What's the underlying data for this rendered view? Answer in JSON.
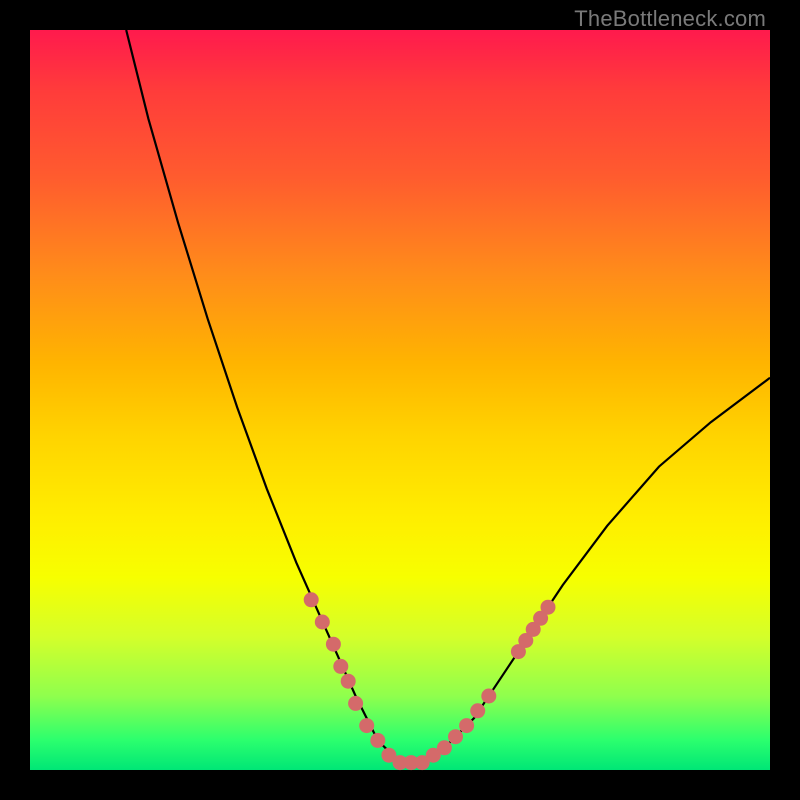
{
  "watermark": "TheBottleneck.com",
  "colors": {
    "frame": "#000000",
    "curve": "#000000",
    "marker": "#d46a6a",
    "gradient_stops": [
      "#ff1a4d",
      "#ff3b3b",
      "#ff5c2e",
      "#ff8c1a",
      "#ffb400",
      "#ffd400",
      "#ffee00",
      "#f7ff00",
      "#d4ff2a",
      "#8fff4d",
      "#2bff6e",
      "#00e676"
    ]
  },
  "chart_data": {
    "type": "line",
    "title": "",
    "xlabel": "",
    "ylabel": "",
    "xlim": [
      0,
      100
    ],
    "ylim": [
      0,
      100
    ],
    "grid": false,
    "legend": false,
    "note": "Axes unlabeled; values are normalized 0–100. y=0 at bottom (green), y=100 at top (red). Curve is a V shape with minimum near x≈50 where y≈0; left branch rises steeply to y≈100 at x≈13; right branch rises more gently to y≈53 at x=100.",
    "series": [
      {
        "name": "curve",
        "x": [
          13,
          16,
          20,
          24,
          28,
          32,
          36,
          40,
          44,
          47,
          50,
          53,
          56,
          60,
          64,
          68,
          72,
          78,
          85,
          92,
          100
        ],
        "y": [
          100,
          88,
          74,
          61,
          49,
          38,
          28,
          19,
          10,
          4,
          1,
          1,
          3,
          7,
          13,
          19,
          25,
          33,
          41,
          47,
          53
        ]
      }
    ],
    "markers": {
      "name": "highlighted-points",
      "note": "Approximate positions of the pink/coral dot clusters along the curve (normalized 0–100).",
      "points": [
        {
          "x": 38,
          "y": 23
        },
        {
          "x": 39.5,
          "y": 20
        },
        {
          "x": 41,
          "y": 17
        },
        {
          "x": 42,
          "y": 14
        },
        {
          "x": 43,
          "y": 12
        },
        {
          "x": 44,
          "y": 9
        },
        {
          "x": 45.5,
          "y": 6
        },
        {
          "x": 47,
          "y": 4
        },
        {
          "x": 48.5,
          "y": 2
        },
        {
          "x": 50,
          "y": 1
        },
        {
          "x": 51.5,
          "y": 1
        },
        {
          "x": 53,
          "y": 1
        },
        {
          "x": 54.5,
          "y": 2
        },
        {
          "x": 56,
          "y": 3
        },
        {
          "x": 57.5,
          "y": 4.5
        },
        {
          "x": 59,
          "y": 6
        },
        {
          "x": 60.5,
          "y": 8
        },
        {
          "x": 62,
          "y": 10
        },
        {
          "x": 66,
          "y": 16
        },
        {
          "x": 67,
          "y": 17.5
        },
        {
          "x": 68,
          "y": 19
        },
        {
          "x": 69,
          "y": 20.5
        },
        {
          "x": 70,
          "y": 22
        }
      ]
    }
  }
}
